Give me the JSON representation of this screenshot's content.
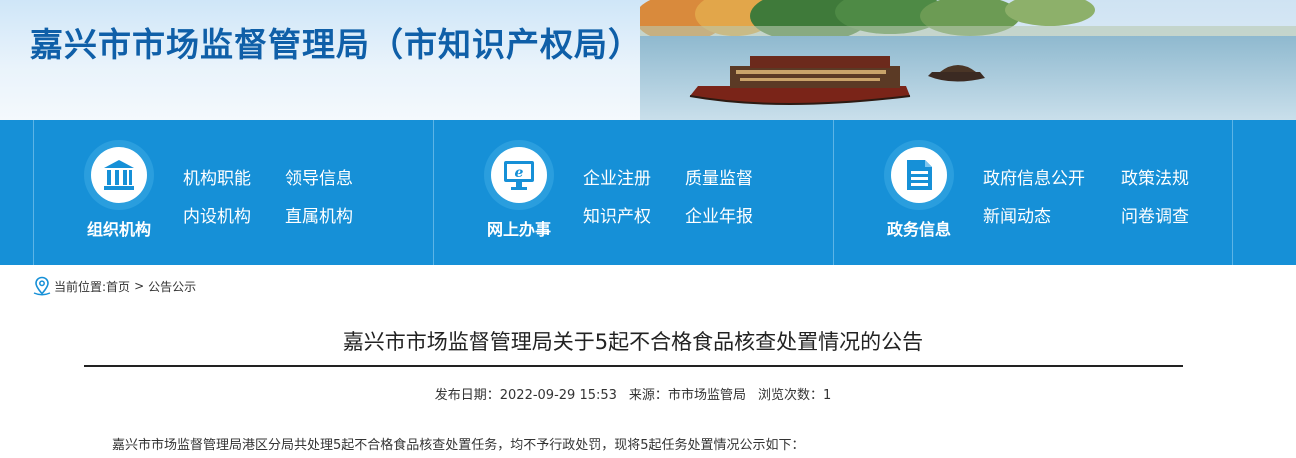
{
  "banner": {
    "title": "嘉兴市市场监督管理局（市知识产权局）"
  },
  "nav": {
    "groups": [
      {
        "label": "组织机构",
        "icon": "building-icon",
        "links": [
          "机构职能",
          "领导信息",
          "内设机构",
          "直属机构"
        ]
      },
      {
        "label": "网上办事",
        "icon": "computer-icon",
        "links": [
          "企业注册",
          "质量监督",
          "知识产权",
          "企业年报"
        ]
      },
      {
        "label": "政务信息",
        "icon": "document-icon",
        "links": [
          "政府信息公开",
          "政策法规",
          "新闻动态",
          "问卷调查"
        ]
      }
    ]
  },
  "breadcrumb": {
    "icon": "location-pin-icon",
    "prefix": "当前位置:",
    "home": "首页",
    "sep": ">",
    "current": "公告公示"
  },
  "article": {
    "title": "嘉兴市市场监督管理局关于5起不合格食品核查处置情况的公告",
    "meta": {
      "date_label": "发布日期：",
      "date": "2022-09-29 15:53",
      "source_label": "来源：",
      "source": "市市场监管局",
      "views_label": "浏览次数：",
      "views": "1"
    },
    "intro": "嘉兴市市场监督管理局港区分局共处理5起不合格食品核查处置任务，均不予行政处罚，现将5起任务处置情况公示如下："
  },
  "colors": {
    "brand_blue": "#1690d7",
    "title_blue": "#0f5fa8"
  }
}
